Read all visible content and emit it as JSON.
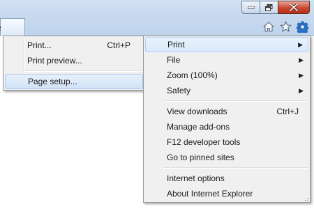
{
  "window": {
    "minimize_icon": "minimize-icon",
    "restore_icon": "restore-icon",
    "close_icon": "close-icon",
    "close_color": "#c9462f"
  },
  "toolbar": {
    "icons": [
      "home-icon",
      "star-icon",
      "gear-icon"
    ],
    "gear_color": "#2a6fc9"
  },
  "print_submenu": {
    "items": [
      {
        "label": "Print...",
        "shortcut": "Ctrl+P"
      },
      {
        "label": "Print preview..."
      },
      {
        "label": "Page setup..."
      }
    ],
    "highlighted": "Page setup..."
  },
  "tools_menu": {
    "items": [
      {
        "label": "Print",
        "submenu": true
      },
      {
        "label": "File",
        "submenu": true
      },
      {
        "label": "Zoom (100%)",
        "submenu": true
      },
      {
        "label": "Safety",
        "submenu": true
      },
      {
        "label": "View downloads",
        "shortcut": "Ctrl+J"
      },
      {
        "label": "Manage add-ons"
      },
      {
        "label": "F12 developer tools"
      },
      {
        "label": "Go to pinned sites"
      },
      {
        "label": "Internet options"
      },
      {
        "label": "About Internet Explorer"
      }
    ],
    "highlighted": "Print",
    "highlight_color": "#d9e8f9"
  }
}
